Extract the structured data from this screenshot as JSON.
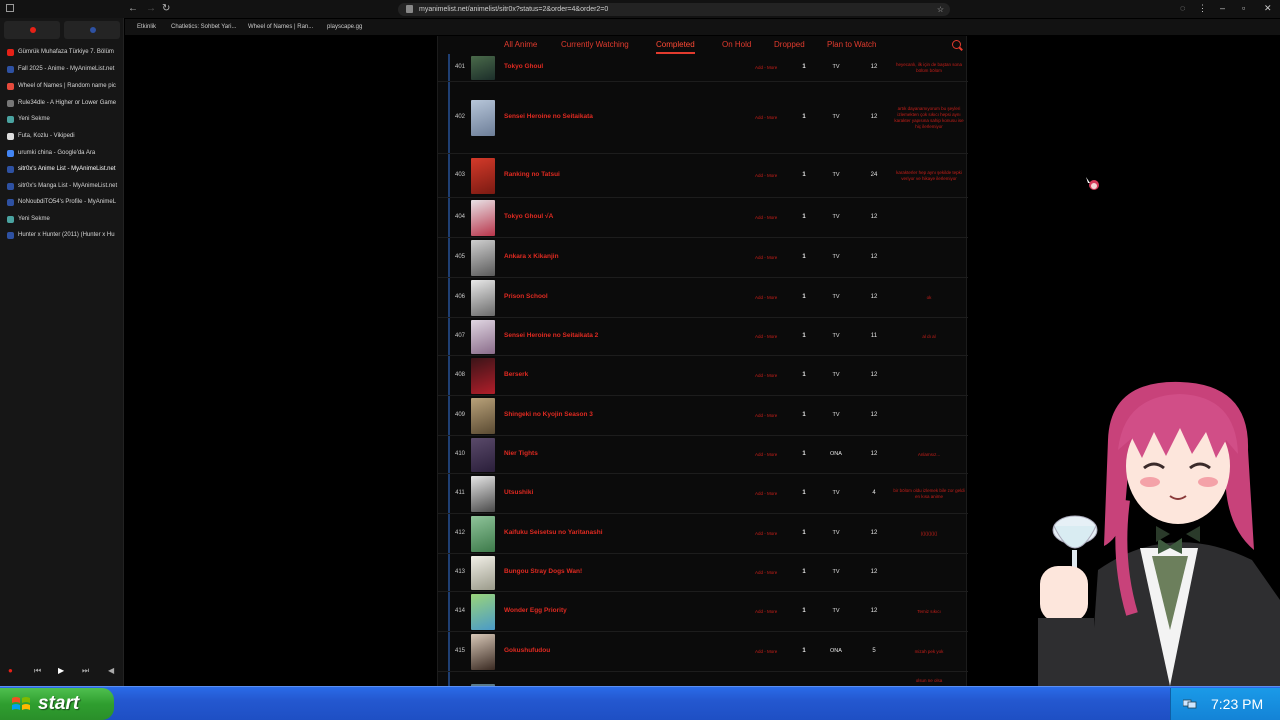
{
  "browser": {
    "url": "myanimelist.net/animelist/sitr0x?status=2&order=4&order2=0"
  },
  "bookmarks": [
    {
      "label": "Etkinlik",
      "color": "#888888"
    },
    {
      "label": "Chatletics: Sohbet Yari...",
      "color": "#e0a030"
    },
    {
      "label": "Wheel of Names | Ran...",
      "color": "#e64a3c"
    },
    {
      "label": "playscape.gg",
      "color": "#4aa3df"
    }
  ],
  "sidebar": {
    "items": [
      {
        "label": "Gümrük Muhafaza Türkiye 7. Bölüm",
        "color": "#e62117"
      },
      {
        "label": "Fall 2025 - Anime - MyAnimeList.net",
        "color": "#2e51a2"
      },
      {
        "label": "Wheel of Names | Random name pic",
        "color": "#e64a3c"
      },
      {
        "label": "Rule34dle - A Higher or Lower Game",
        "color": "#777777"
      },
      {
        "label": "Yeni Sekme",
        "color": "#4aa3a0"
      },
      {
        "label": "Futa, Kozlu - Vikipedi",
        "color": "#dddddd"
      },
      {
        "label": "urumki china - Google'da Ara",
        "color": "#4285f4"
      },
      {
        "label": "sitr0x's Anime List - MyAnimeList.net",
        "color": "#2e51a2"
      },
      {
        "label": "sitr0x's Manga List - MyAnimeList.net",
        "color": "#2e51a2"
      },
      {
        "label": "NoNoubdiTO54's Profile - MyAnimeL",
        "color": "#2e51a2"
      },
      {
        "label": "Yeni Sekme",
        "color": "#4aa3a0"
      },
      {
        "label": "Hunter x Hunter (2011) (Hunter x Hu",
        "color": "#2e51a2"
      }
    ]
  },
  "tabs": [
    "All Anime",
    "Currently Watching",
    "Completed",
    "On Hold",
    "Dropped",
    "Plan to Watch"
  ],
  "active_tab": "Completed",
  "row_action_label": "Add - More",
  "rows": [
    {
      "num": "401",
      "title": "Tokyo Ghoul",
      "score": "1",
      "type": "TV",
      "eps": "12",
      "notes": "heyecanlı, ilk için de baştan sona bölüm bölüm",
      "colors": [
        "#4a6a4a",
        "#1c2e2a"
      ]
    },
    {
      "num": "402",
      "title": "Sensei Heroine no Seitaikata",
      "score": "1",
      "type": "TV",
      "eps": "12",
      "notes": "artık dayanamıyorum bu şeyleri izlemekten çok sıkıcı hepsi aynı karakter yapısına sahip konusu ise hiç ilerlemiyor",
      "colors": [
        "#b7c6d9",
        "#6d7e98"
      ]
    },
    {
      "num": "403",
      "title": "Ranking no Tatsui",
      "score": "1",
      "type": "TV",
      "eps": "24",
      "notes": "karakterler hep aynı şekilde tepki veriyor ve hikaye ilerlemiyor",
      "colors": [
        "#d43a2a",
        "#7a1a12"
      ]
    },
    {
      "num": "404",
      "title": "Tokyo Ghoul √A",
      "score": "1",
      "type": "TV",
      "eps": "12",
      "notes": "",
      "colors": [
        "#e8e2e6",
        "#b8344a"
      ]
    },
    {
      "num": "405",
      "title": "Ankara x Kikanjin",
      "score": "1",
      "type": "TV",
      "eps": "12",
      "notes": "",
      "colors": [
        "#cfcfcf",
        "#5a5a5a"
      ]
    },
    {
      "num": "406",
      "title": "Prison School",
      "score": "1",
      "type": "TV",
      "eps": "12",
      "notes": "ok",
      "colors": [
        "#e8e8e8",
        "#6a6a6a"
      ]
    },
    {
      "num": "407",
      "title": "Sensei Heroine no Seitaikata 2",
      "score": "1",
      "type": "TV",
      "eps": "11",
      "notes": "al dı al",
      "colors": [
        "#e0d6e2",
        "#8a6c8a"
      ]
    },
    {
      "num": "408",
      "title": "Berserk",
      "score": "1",
      "type": "TV",
      "eps": "12",
      "notes": "",
      "colors": [
        "#3a1418",
        "#b21e2a"
      ]
    },
    {
      "num": "409",
      "title": "Shingeki no Kyojin Season 3",
      "score": "1",
      "type": "TV",
      "eps": "12",
      "notes": "",
      "colors": [
        "#b9a27a",
        "#5a4a32"
      ]
    },
    {
      "num": "410",
      "title": "Nier Tights",
      "score": "1",
      "type": "ONA",
      "eps": "12",
      "notes": "Anlamsız...",
      "colors": [
        "#5a4a6a",
        "#2a1e3a"
      ]
    },
    {
      "num": "411",
      "title": "Utsushiki",
      "score": "1",
      "type": "TV",
      "eps": "4",
      "notes": "bir bölüm oldu izlemek bile zor geldi en kısa anime",
      "colors": [
        "#e6e6e6",
        "#4a4a4a"
      ]
    },
    {
      "num": "412",
      "title": "Kaifuku Seisetsu no Yaritanashi",
      "score": "1",
      "type": "TV",
      "eps": "12",
      "notes": "(((((((((((",
      "colors": [
        "#8fc49a",
        "#3d7a4a"
      ]
    },
    {
      "num": "413",
      "title": "Bungou Stray Dogs Wan!",
      "score": "1",
      "type": "TV",
      "eps": "12",
      "notes": "",
      "colors": [
        "#f2f0e8",
        "#9a9a8a"
      ]
    },
    {
      "num": "414",
      "title": "Wonder Egg Priority",
      "score": "1",
      "type": "TV",
      "eps": "12",
      "notes": "Temiz sıkıcı",
      "colors": [
        "#9ad47a",
        "#4a9ac8"
      ]
    },
    {
      "num": "415",
      "title": "Gokushufudou",
      "score": "1",
      "type": "ONA",
      "eps": "5",
      "notes": "mizah pek yok",
      "colors": [
        "#d8c8b8",
        "#3a2a22"
      ]
    }
  ],
  "partial_row_notes": "olsun ne olsa",
  "taskbar": {
    "start_label": "start",
    "clock": "7:23 PM"
  }
}
